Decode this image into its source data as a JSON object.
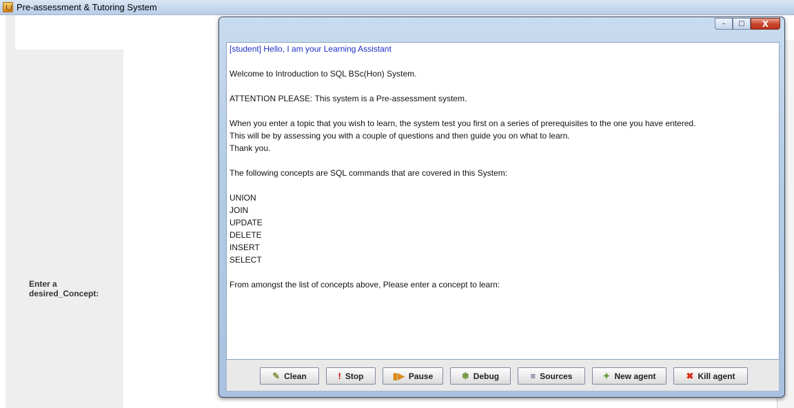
{
  "main_window": {
    "title": "Pre-assessment & Tutoring System",
    "concept_label": "Enter a desired_Concept:"
  },
  "agent_window": {
    "controls": {
      "minimize": "–",
      "maximize": "□",
      "close": "X"
    },
    "console_lines": [
      {
        "text": "[student] Hello, I am your Learning Assistant",
        "style": "blue"
      },
      {
        "text": ""
      },
      {
        "text": "Welcome to Introduction to SQL BSc(Hon) System."
      },
      {
        "text": ""
      },
      {
        "text": "ATTENTION PLEASE: This system is a Pre-assessment system."
      },
      {
        "text": ""
      },
      {
        "text": "When you enter a topic that you wish to learn, the system test you first on a series of prerequisites to the one you have entered."
      },
      {
        "text": "This will be by assessing you with a couple of questions and then guide you on what to learn."
      },
      {
        "text": "Thank you."
      },
      {
        "text": ""
      },
      {
        "text": "The following concepts are SQL commands that are covered in this System:"
      },
      {
        "text": ""
      },
      {
        "text": "UNION"
      },
      {
        "text": "JOIN"
      },
      {
        "text": "UPDATE"
      },
      {
        "text": "DELETE"
      },
      {
        "text": "INSERT"
      },
      {
        "text": "SELECT"
      },
      {
        "text": ""
      },
      {
        "text": "From amongst the list of concepts above, Please enter a concept to learn:"
      }
    ],
    "buttons": {
      "clean": {
        "label": "Clean",
        "icon": "eraser-icon"
      },
      "stop": {
        "label": "Stop",
        "icon": "exclamation-icon"
      },
      "pause": {
        "label": "Pause",
        "icon": "pause-play-icon"
      },
      "debug": {
        "label": "Debug",
        "icon": "bug-icon"
      },
      "sources": {
        "label": "Sources",
        "icon": "list-icon"
      },
      "new_agent": {
        "label": "New agent",
        "icon": "new-agent-icon"
      },
      "kill_agent": {
        "label": "Kill agent",
        "icon": "kill-x-icon"
      }
    }
  },
  "colors": {
    "console_blue_text": "#1c2ec4",
    "window_frame": "#b5cce6",
    "close_button": "#c8432a"
  }
}
